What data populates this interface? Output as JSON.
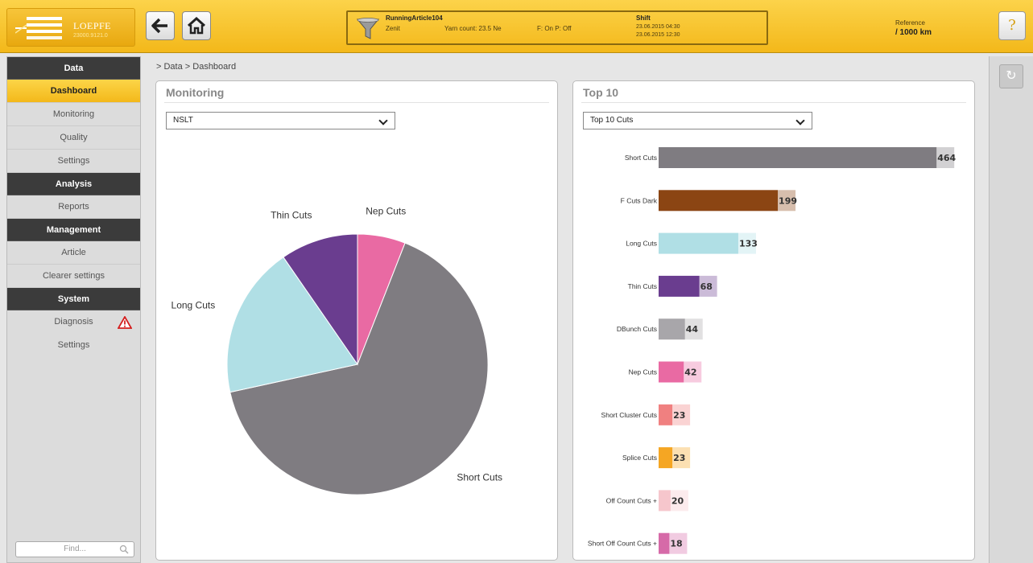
{
  "header": {
    "logo_name": "LOEPFE",
    "logo_version": "23000.9121.0",
    "article_title": "RunningArticle104",
    "article_sub": "Zenit",
    "yarn_count": "Yarn count: 23.5 Ne",
    "f_status": "F: On P: Off",
    "shift_title": "Shift",
    "shift_start": "23.06.2015 04:30",
    "shift_end": "23.06.2015 12:30",
    "reference_label": "Reference",
    "reference_value": "/ 1000 km",
    "help_icon": "?"
  },
  "sidebar": {
    "sections": [
      {
        "title": "Data",
        "items": [
          {
            "label": "Dashboard",
            "active": true
          },
          {
            "label": "Monitoring"
          },
          {
            "label": "Quality"
          },
          {
            "label": "Settings"
          }
        ]
      },
      {
        "title": "Analysis",
        "items": [
          {
            "label": "Reports"
          }
        ]
      },
      {
        "title": "Management",
        "items": [
          {
            "label": "Article"
          },
          {
            "label": "Clearer settings"
          }
        ]
      },
      {
        "title": "System",
        "items": [
          {
            "label": "Diagnosis",
            "warning": true
          },
          {
            "label": "Settings"
          }
        ]
      }
    ],
    "find_placeholder": "Find..."
  },
  "breadcrumb": "> Data > Dashboard",
  "monitoring": {
    "title": "Monitoring",
    "select_value": "NSLT"
  },
  "top10": {
    "title": "Top 10",
    "select_value": "Top 10 Cuts"
  },
  "colors": {
    "accent": "#f5bd1f",
    "grey": "#7f7c81",
    "brown": "#8b4513",
    "lightblue": "#b0dfe5",
    "purple": "#6a3d8f",
    "pink": "#e96aa3"
  },
  "chart_data": [
    {
      "type": "pie",
      "title": "",
      "slices": [
        {
          "label": "Nep Cuts",
          "value": 42,
          "color": "#e96aa3"
        },
        {
          "label": "Short Cuts",
          "value": 464,
          "color": "#7f7c81"
        },
        {
          "label": "Long Cuts",
          "value": 133,
          "color": "#b0dfe5"
        },
        {
          "label": "Thin Cuts",
          "value": 68,
          "color": "#6a3d8f"
        }
      ]
    },
    {
      "type": "bar",
      "orientation": "horizontal",
      "title": "",
      "max": 500,
      "categories": [
        "Short Cuts",
        "F Cuts Dark",
        "Long Cuts",
        "Thin Cuts",
        "DBunch Cuts",
        "Nep Cuts",
        "Short Cluster Cuts",
        "Splice Cuts",
        "Off Count Cuts +",
        "Short Off Count Cuts +"
      ],
      "values": [
        464,
        199,
        133,
        68,
        44,
        42,
        23,
        23,
        20,
        18
      ],
      "colors": [
        "#7f7c81",
        "#8b4513",
        "#b0dfe5",
        "#6a3d8f",
        "#a8a6aa",
        "#e96aa3",
        "#f08080",
        "#f5a623",
        "#f6c6cc",
        "#d66aa8"
      ]
    }
  ]
}
